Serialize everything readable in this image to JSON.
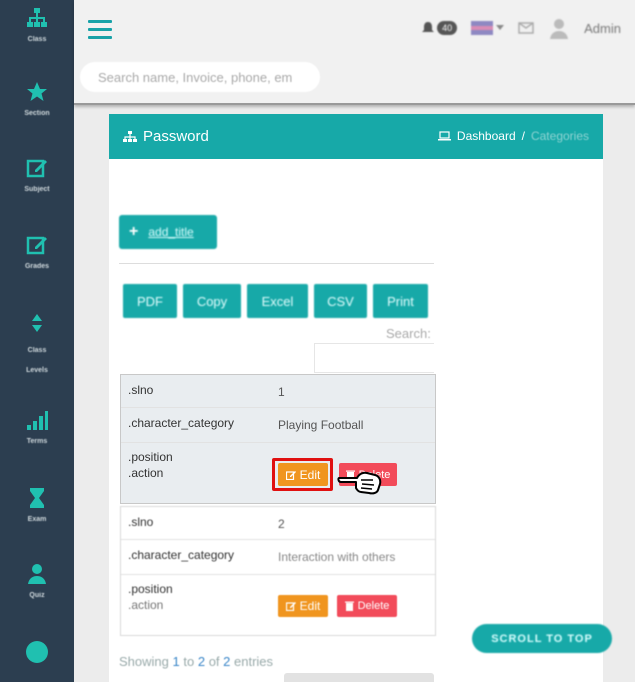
{
  "sidebar": {
    "items": [
      {
        "label": "Class",
        "icon": "sitemap-icon"
      },
      {
        "label": "Section",
        "icon": "star-icon"
      },
      {
        "label": "Subject",
        "icon": "edit-icon"
      },
      {
        "label": "Grades",
        "icon": "edit-icon"
      },
      {
        "label": "Class Levels",
        "icon": "sort-icon"
      },
      {
        "label": "Terms",
        "icon": "signal-icon"
      },
      {
        "label": "Exam",
        "icon": "hourglass-icon"
      },
      {
        "label": "Quiz",
        "icon": "person-icon"
      }
    ]
  },
  "topbar": {
    "notification_count": "40",
    "admin_label": "Admin",
    "search_placeholder": "Search name, Invoice, phone, em"
  },
  "card": {
    "title": "Password",
    "breadcrumb": {
      "home": "Dashboard",
      "separator": "/",
      "current": "Categories"
    }
  },
  "toolbar": {
    "add_label": "add_title",
    "export_buttons": [
      "PDF",
      "Copy",
      "Excel",
      "CSV",
      "Print"
    ],
    "search_label": "Search:"
  },
  "records": [
    {
      "keys": {
        "slno": ".slno",
        "category": ".character_category",
        "position": ".position",
        "action": ".action"
      },
      "slno": "1",
      "category": "Playing Football",
      "edit_label": "Edit",
      "delete_label": "Delete"
    },
    {
      "keys": {
        "slno": ".slno",
        "category": ".character_category",
        "position": ".position",
        "action": ".action"
      },
      "slno": "2",
      "category": "Interaction with others",
      "edit_label": "Edit",
      "delete_label": "Delete"
    }
  ],
  "footer": {
    "showing_prefix": "Showing",
    "from": "1",
    "to_word": "to",
    "to": "2",
    "of_word": "of",
    "total": "2",
    "suffix": "entries"
  },
  "scroll_top_label": "SCROLL TO TOP",
  "colors": {
    "accent": "#17a9a8",
    "sidebar": "#2c3e50",
    "edit": "#f0951f",
    "delete": "#f24b5a",
    "focus": "#e01010"
  }
}
